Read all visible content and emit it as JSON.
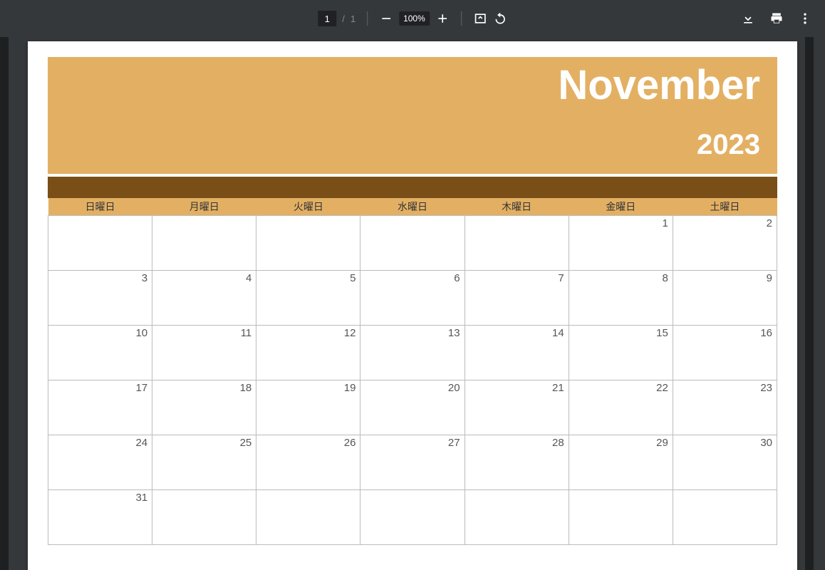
{
  "toolbar": {
    "page_current": "1",
    "page_sep": "/",
    "page_total": "1",
    "zoom_label": "100%"
  },
  "calendar": {
    "month": "November",
    "year": "2023",
    "day_headers": [
      "日曜日",
      "月曜日",
      "火曜日",
      "水曜日",
      "木曜日",
      "金曜日",
      "土曜日"
    ],
    "weeks": [
      [
        "",
        "",
        "",
        "",
        "",
        "1",
        "2"
      ],
      [
        "3",
        "4",
        "5",
        "6",
        "7",
        "8",
        "9"
      ],
      [
        "10",
        "11",
        "12",
        "13",
        "14",
        "15",
        "16"
      ],
      [
        "17",
        "18",
        "19",
        "20",
        "21",
        "22",
        "23"
      ],
      [
        "24",
        "25",
        "26",
        "27",
        "28",
        "29",
        "30"
      ],
      [
        "31",
        "",
        "",
        "",
        "",
        "",
        ""
      ]
    ]
  }
}
